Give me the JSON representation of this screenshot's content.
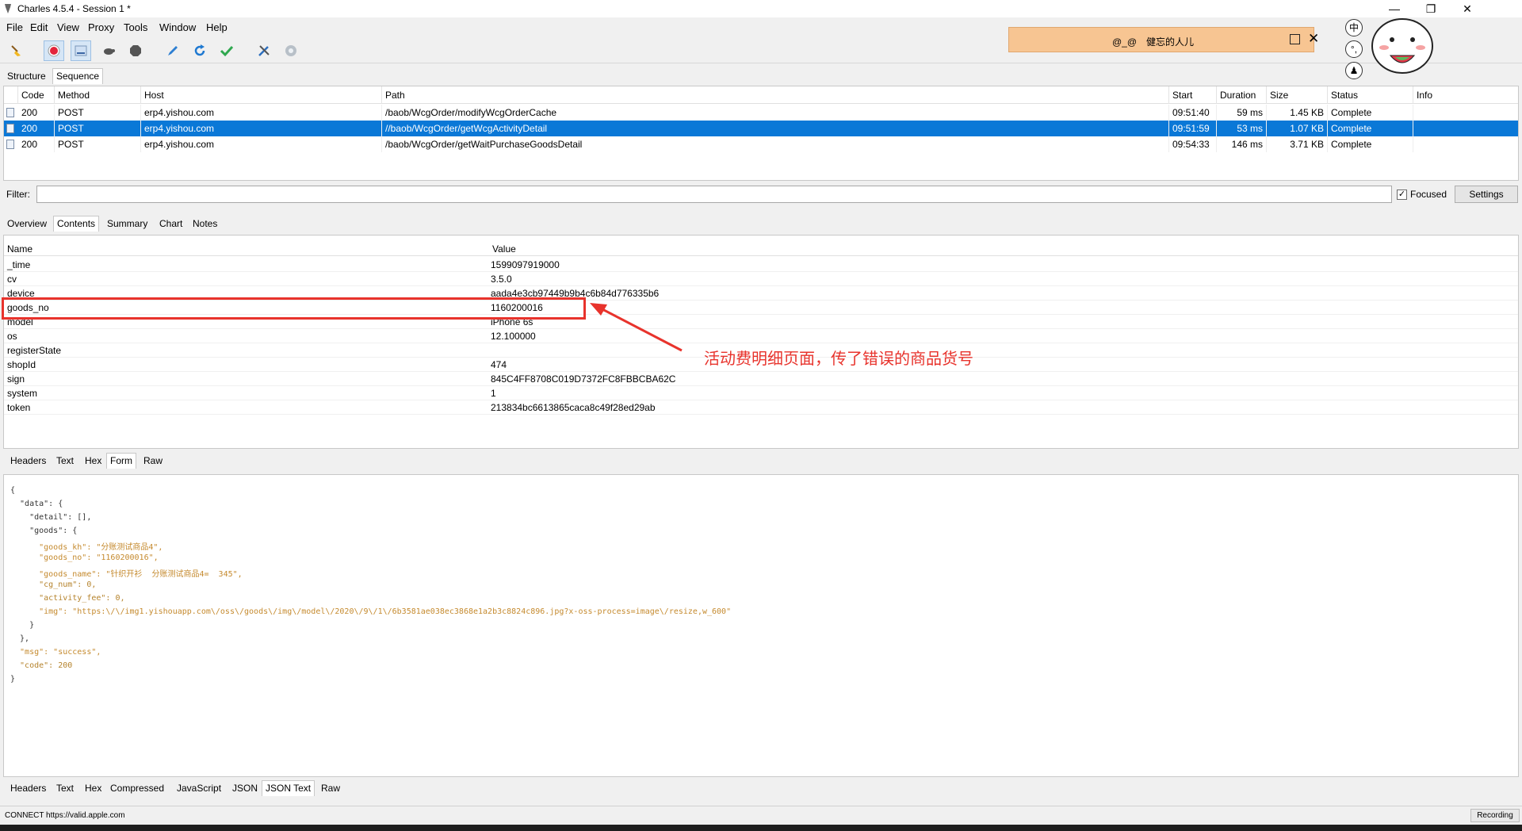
{
  "window": {
    "title": "Charles 4.5.4 - Session 1 *"
  },
  "menu": [
    "File",
    "Edit",
    "View",
    "Proxy",
    "Tools",
    "Window",
    "Help"
  ],
  "toolbar": {
    "icons": [
      "broom-icon",
      "record-icon",
      "throttle-icon",
      "turtle-icon",
      "stop-icon",
      "compose-pen-icon",
      "refresh-icon",
      "validate-check-icon",
      "tools-icon",
      "settings-gear-icon"
    ]
  },
  "view_tabs": [
    "Structure",
    "Sequence"
  ],
  "sessions": {
    "columns": [
      "Code",
      "Method",
      "Host",
      "Path",
      "Start",
      "Duration",
      "Size",
      "Status",
      "Info"
    ],
    "rows": [
      {
        "code": "200",
        "method": "POST",
        "host": "erp4.yishou.com",
        "path": "/baob/WcgOrder/modifyWcgOrderCache",
        "start": "09:51:40",
        "duration": "59 ms",
        "size": "1.45 KB",
        "status": "Complete",
        "info": ""
      },
      {
        "code": "200",
        "method": "POST",
        "host": "erp4.yishou.com",
        "path": "//baob/WcgOrder/getWcgActivityDetail",
        "start": "09:51:59",
        "duration": "53 ms",
        "size": "1.07 KB",
        "status": "Complete",
        "info": ""
      },
      {
        "code": "200",
        "method": "POST",
        "host": "erp4.yishou.com",
        "path": "/baob/WcgOrder/getWaitPurchaseGoodsDetail",
        "start": "09:54:33",
        "duration": "146 ms",
        "size": "3.71 KB",
        "status": "Complete",
        "info": ""
      }
    ]
  },
  "filter": {
    "label": "Filter:",
    "value": "",
    "focused_label": "Focused",
    "focused_checked": true,
    "settings_label": "Settings"
  },
  "detail_tabs": [
    "Overview",
    "Contents",
    "Summary",
    "Chart",
    "Notes"
  ],
  "form": {
    "columns": [
      "Name",
      "Value"
    ],
    "rows": [
      {
        "name": "_time",
        "value": "1599097919000"
      },
      {
        "name": "cv",
        "value": "3.5.0"
      },
      {
        "name": "device",
        "value": "aada4e3cb97449b9b4c6b84d776335b6"
      },
      {
        "name": "goods_no",
        "value": "1160200016"
      },
      {
        "name": "model",
        "value": "iPhone 6s"
      },
      {
        "name": "os",
        "value": "12.100000"
      },
      {
        "name": "registerState",
        "value": ""
      },
      {
        "name": "shopId",
        "value": "474"
      },
      {
        "name": "sign",
        "value": "845C4FF8708C019D7372FC8FBBCBA62C"
      },
      {
        "name": "system",
        "value": "1"
      },
      {
        "name": "token",
        "value": "213834bc6613865caca8c49f28ed29ab"
      }
    ]
  },
  "request_tabs": [
    "Headers",
    "Text",
    "Hex",
    "Form",
    "Raw"
  ],
  "json_lines": [
    "{",
    "  \"data\": {",
    "    \"detail\": [],",
    "    \"goods\": {",
    "      \"goods_kh\": \"分账测试商品4\",",
    "      \"goods_no\": \"1160200016\",",
    "      \"goods_name\": \"针织开衫  分账测试商品4=  345\",",
    "      \"cg_num\": 0,",
    "      \"activity_fee\": 0,",
    "      \"img\": \"https:\\/\\/img1.yishouapp.com\\/oss\\/goods\\/img\\/model\\/2020\\/9\\/1\\/6b3581ae038ec3868e1a2b3c8824c896.jpg?x-oss-process=image\\/resize,w_600\"",
    "    }",
    "  },",
    "  \"msg\": \"success\",",
    "  \"code\": 200",
    "}"
  ],
  "response_tabs": [
    "Headers",
    "Text",
    "Hex",
    "Compressed",
    "JavaScript",
    "JSON",
    "JSON Text",
    "Raw"
  ],
  "status": {
    "text": "CONNECT https://valid.apple.com",
    "recording": "Recording"
  },
  "annotation": {
    "text": "活动费明细页面，传了错误的商品货号",
    "color": "#e8332c"
  },
  "notification": {
    "text": "@_@　健忘的人儿"
  },
  "ime": [
    "中"
  ],
  "colors": {
    "selection": "#0a78d7",
    "annotation": "#e8332c",
    "notification": "#f7c592"
  }
}
